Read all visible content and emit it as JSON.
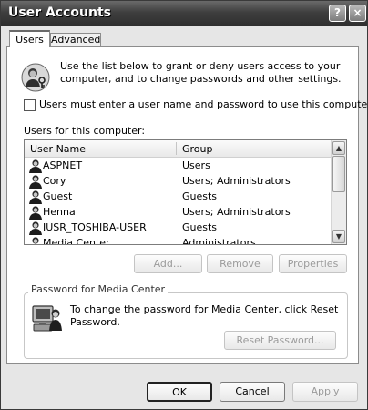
{
  "window": {
    "title": "User Accounts",
    "help_glyph": "?",
    "close_glyph": "×"
  },
  "tabs": [
    {
      "label": "Users",
      "selected": true
    },
    {
      "label": "Advanced",
      "selected": false
    }
  ],
  "users_tab": {
    "intro_text": "Use the list below to grant or deny users access to your computer, and to change passwords and other settings.",
    "require_password_label": "Users must enter a user name and password to use this computer.",
    "require_password_checked": false,
    "list_label": "Users for this computer:",
    "columns": [
      "User Name",
      "Group"
    ],
    "rows": [
      {
        "name": "ASPNET",
        "group": "Users"
      },
      {
        "name": "Cory",
        "group": "Users; Administrators"
      },
      {
        "name": "Guest",
        "group": "Guests"
      },
      {
        "name": "Henna",
        "group": "Users; Administrators"
      },
      {
        "name": "IUSR_TOSHIBA-USER",
        "group": "Guests"
      },
      {
        "name": "Media Center",
        "group": "Administrators"
      }
    ],
    "buttons": {
      "add": "Add...",
      "remove": "Remove",
      "properties": "Properties"
    },
    "password_group": {
      "title": "Password for Media Center",
      "text": "To change the password for Media Center, click Reset Password.",
      "reset_button": "Reset Password..."
    }
  },
  "dialog_buttons": {
    "ok": "OK",
    "cancel": "Cancel",
    "apply": "Apply"
  },
  "icons": {
    "intro": "users-keys-icon",
    "user": "user-icon",
    "media": "computer-user-icon"
  }
}
